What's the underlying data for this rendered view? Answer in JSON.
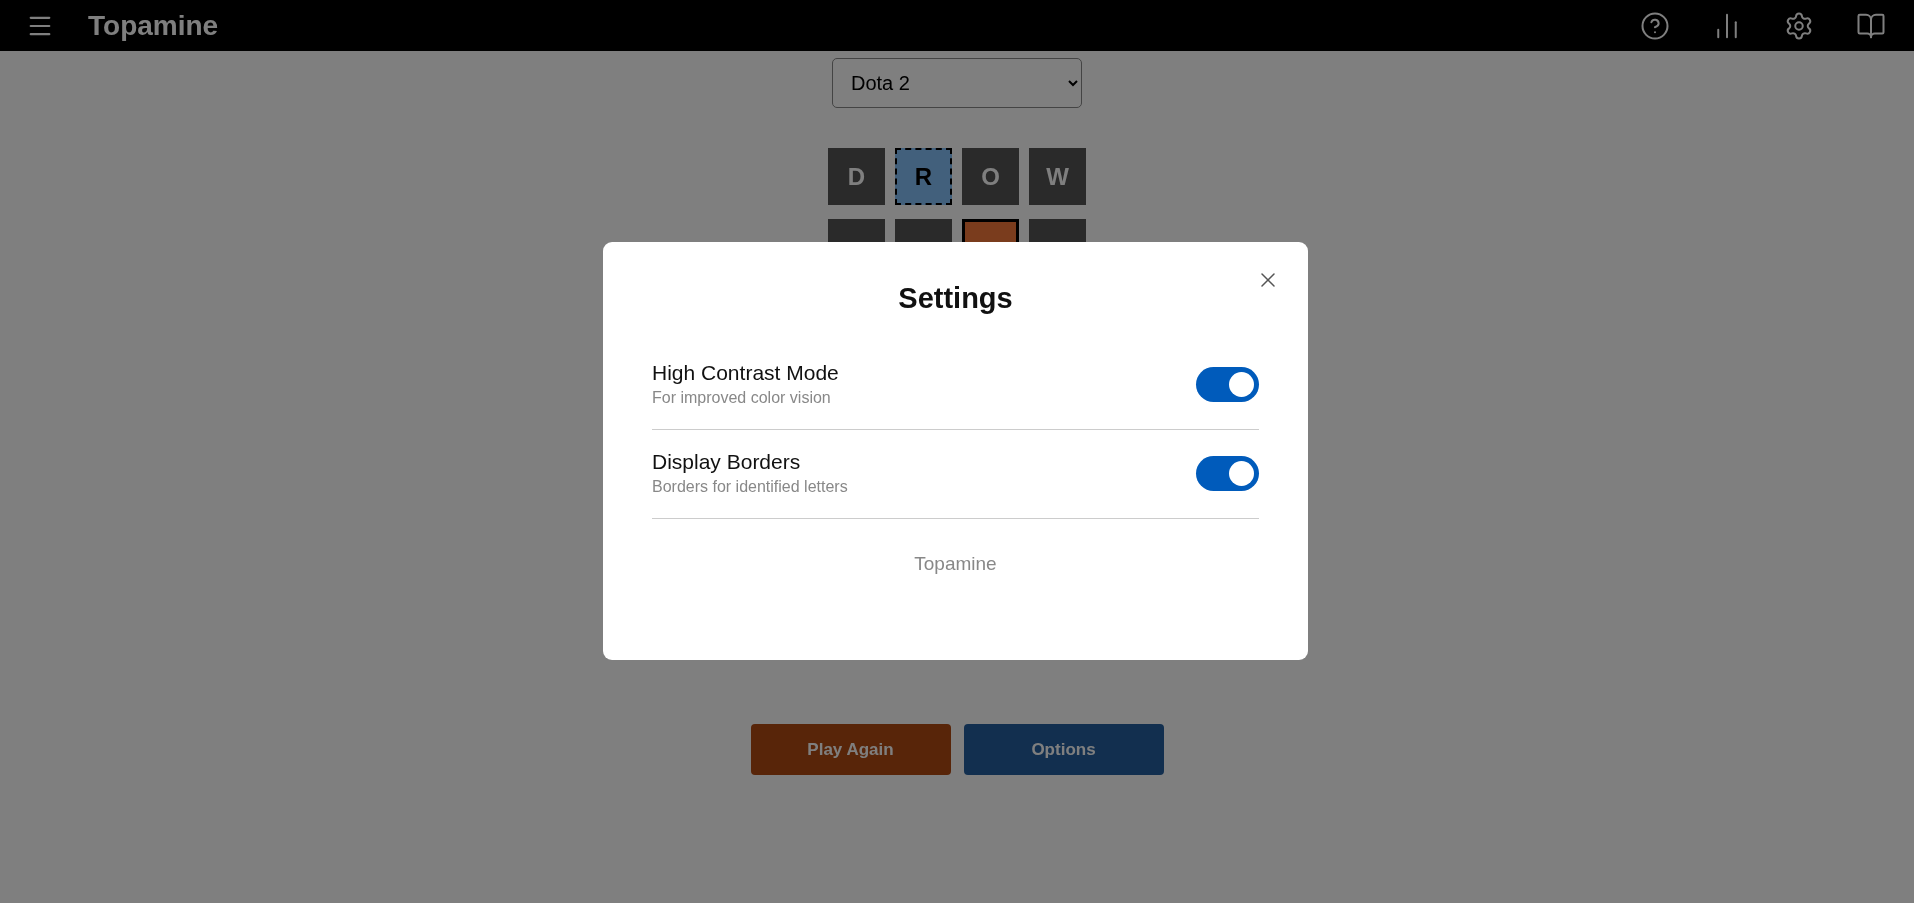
{
  "header": {
    "title": "Topamine"
  },
  "game_select": {
    "value": "Dota 2"
  },
  "board": [
    {
      "tiles": [
        {
          "letter": "D",
          "kind": "absent"
        },
        {
          "letter": "R",
          "kind": "present"
        },
        {
          "letter": "O",
          "kind": "absent"
        },
        {
          "letter": "W",
          "kind": "absent"
        }
      ]
    },
    {
      "tiles": [
        {
          "kind": "absent"
        },
        {
          "kind": "absent"
        },
        {
          "kind": "correct"
        },
        {
          "kind": "absent"
        }
      ]
    }
  ],
  "actions": [
    {
      "label": "Play Again",
      "kind": "primary"
    },
    {
      "label": "Options",
      "kind": "secondary"
    }
  ],
  "settings_dialog": {
    "title": "Settings",
    "options": [
      {
        "label": "High Contrast Mode",
        "description": "For improved color vision",
        "on": true
      },
      {
        "label": "Display Borders",
        "description": "Borders for identified letters",
        "on": true
      }
    ],
    "footer": "Topamine"
  }
}
